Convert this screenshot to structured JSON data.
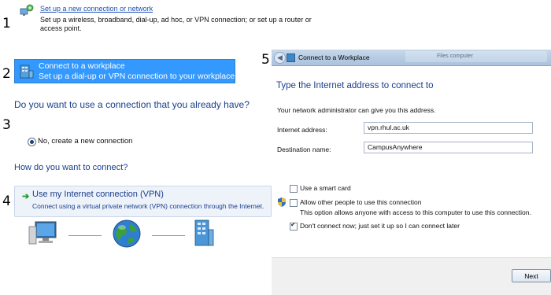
{
  "steps": {
    "s1": "1",
    "s2": "2",
    "s3": "3",
    "s4": "4",
    "s5": "5"
  },
  "new_connection": {
    "link": "Set up a new connection or network",
    "desc": "Set up a wireless, broadband, dial-up, ad hoc, or VPN connection; or set up a router or access point.",
    "icon": "network-setup-icon"
  },
  "workplace": {
    "title": "Connect to a workplace",
    "desc": "Set up a dial-up or VPN connection to your workplace.",
    "icon": "workplace-icon"
  },
  "existing": {
    "question": "Do you want to use a connection that you already have?",
    "radio_label": "No, create a new connection"
  },
  "how": {
    "question": "How do you want to connect?",
    "vpn_title": "Use my Internet connection (VPN)",
    "vpn_desc": "Connect using a virtual private network (VPN) connection through the Internet."
  },
  "diagram": {
    "icons": [
      "computer-icon",
      "globe-icon",
      "server-icon"
    ]
  },
  "dialog": {
    "window_title": "Connect to a Workplace",
    "tab_text": "Files computer",
    "heading": "Type the Internet address to connect to",
    "info": "Your network administrator can give you this address.",
    "internet_address_label": "Internet address:",
    "internet_address_value": "vpn.rhul.ac.uk",
    "destination_label": "Destination name:",
    "destination_value": "CampusAnywhere",
    "smart_card_label": "Use a smart card",
    "allow_others_label": "Allow other people to use this connection",
    "allow_others_desc": "This option allows anyone with access to this computer to use this connection.",
    "dont_connect_label": "Don't connect now; just set it up so I can connect later",
    "next_label": "Next"
  },
  "colors": {
    "link": "#1c4fb8",
    "heading": "#1a3e8c",
    "selection": "#3399ff"
  }
}
